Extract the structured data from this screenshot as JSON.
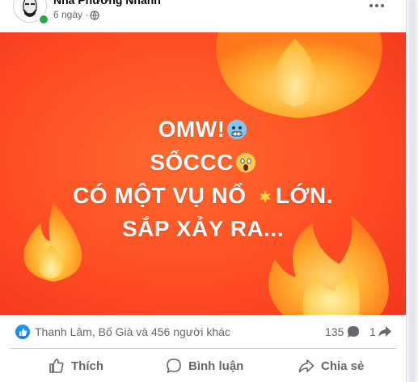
{
  "post": {
    "author": "Nhà Phương Nhanh",
    "time": "6 ngày",
    "separator": "·"
  },
  "image": {
    "lines": [
      "OMW!",
      "SỐCCC",
      "CÓ MỘT VỤ NỔ",
      "LỚN.",
      "SẮP XẢY RA..."
    ],
    "emojis": [
      "cold-face-emoji",
      "screaming-face-emoji",
      "collision-emoji"
    ],
    "colors": {
      "background": "#ff4d24",
      "text": "#ffffff",
      "flame_outer": "#ff7a1a",
      "flame_inner": "#ffd84a"
    }
  },
  "reactions": {
    "summary": "Thanh Lâm, Bố Già và 456 người khác",
    "comments": "135",
    "shares": "1"
  },
  "actions": {
    "like": "Thích",
    "comment": "Bình luận",
    "share": "Chia sẻ"
  },
  "colors": {
    "accent": "#1877f2",
    "muted": "#65676b"
  }
}
